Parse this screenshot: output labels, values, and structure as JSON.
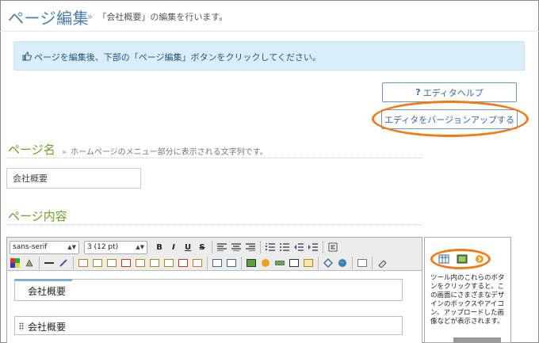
{
  "header": {
    "title": "ページ編集",
    "separator": "»",
    "subtitle": "「会社概要」の編集を行います。"
  },
  "info_box": {
    "icon": "thumbs-up-icon",
    "text": "ページを編集後、下部の「ページ編集」ボタンをクリックしてください。"
  },
  "buttons": {
    "help_icon": "?",
    "help_label": "エディタヘルプ",
    "upgrade_label": "エディタをバージョンアップする"
  },
  "page_name_section": {
    "title": "ページ名",
    "separator": "»",
    "description": "ホームページのメニュー部分に表示される文字列です。",
    "value": "会社概要"
  },
  "page_content_section": {
    "title": "ページ内容"
  },
  "editor": {
    "font_select": "sans-serif",
    "size_select": "3 (12 pt)",
    "format_buttons": [
      "B",
      "I",
      "U",
      "S"
    ],
    "content_blocks": [
      "会社概要",
      "会社概要"
    ]
  },
  "side_panel": {
    "text": "ツール内のこれらのボタンをクリックすると、この画面にさまざまなデザインのボックスやアイコン、アップロードした画像などが表示されます。"
  },
  "colors": {
    "title_blue": "#4a7ea8",
    "section_green": "#6f9f2a",
    "info_bg": "#d9eef9",
    "highlight_orange": "#ef7b1a",
    "button_border": "#6b96c8"
  }
}
